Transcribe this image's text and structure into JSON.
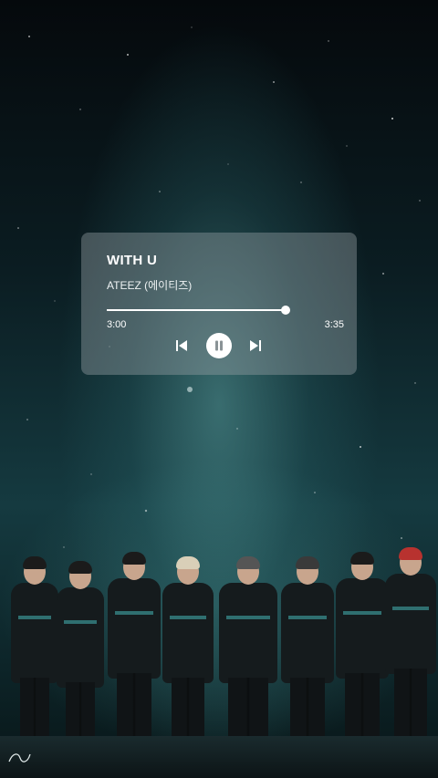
{
  "player": {
    "title": "WITH U",
    "artist": "ATEEZ (에이티즈)",
    "current_time": "3:00",
    "total_time": "3:35",
    "progress": 0.837,
    "state": "playing",
    "controls": [
      "previous-icon",
      "pause-icon",
      "next-icon"
    ]
  },
  "colors": {
    "card_bg": "rgba(150,160,165,0.42)",
    "text": "#ffffff",
    "background_teal": "#153a40"
  }
}
